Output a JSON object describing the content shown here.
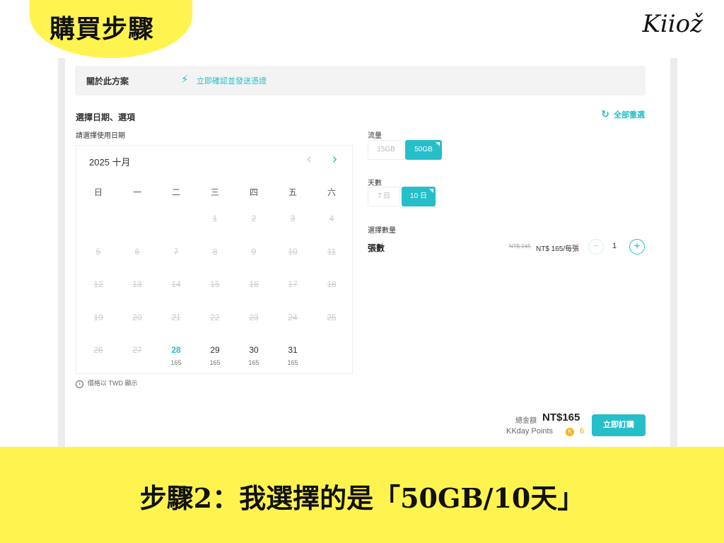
{
  "header": {
    "badge": "購買步驟",
    "logo": "Kiiož"
  },
  "about": {
    "title": "關於此方案",
    "icon": "lightning-icon",
    "link": "立即確認並發送憑證"
  },
  "section": {
    "title": "選擇日期、選項",
    "reset": "全部重選",
    "date_prompt": "請選擇使用日期"
  },
  "calendar": {
    "month": "2025 十月",
    "weekdays": [
      "日",
      "一",
      "二",
      "三",
      "四",
      "五",
      "六"
    ],
    "rows": [
      [
        null,
        null,
        null,
        {
          "d": "1",
          "s": "disabled"
        },
        {
          "d": "2",
          "s": "disabled"
        },
        {
          "d": "3",
          "s": "disabled"
        },
        {
          "d": "4",
          "s": "disabled"
        }
      ],
      [
        {
          "d": "5",
          "s": "disabled"
        },
        {
          "d": "6",
          "s": "disabled"
        },
        {
          "d": "7",
          "s": "disabled"
        },
        {
          "d": "8",
          "s": "disabled"
        },
        {
          "d": "9",
          "s": "disabled"
        },
        {
          "d": "10",
          "s": "disabled"
        },
        {
          "d": "11",
          "s": "disabled"
        }
      ],
      [
        {
          "d": "12",
          "s": "disabled"
        },
        {
          "d": "13",
          "s": "disabled"
        },
        {
          "d": "14",
          "s": "disabled"
        },
        {
          "d": "15",
          "s": "disabled"
        },
        {
          "d": "16",
          "s": "disabled"
        },
        {
          "d": "17",
          "s": "disabled"
        },
        {
          "d": "18",
          "s": "disabled"
        }
      ],
      [
        {
          "d": "19",
          "s": "disabled"
        },
        {
          "d": "20",
          "s": "disabled"
        },
        {
          "d": "21",
          "s": "disabled"
        },
        {
          "d": "22",
          "s": "disabled"
        },
        {
          "d": "23",
          "s": "disabled"
        },
        {
          "d": "24",
          "s": "disabled"
        },
        {
          "d": "25",
          "s": "disabled"
        }
      ],
      [
        {
          "d": "26",
          "s": "disabled"
        },
        {
          "d": "27",
          "s": "disabled"
        },
        {
          "d": "28",
          "s": "selected",
          "p": "165"
        },
        {
          "d": "29",
          "s": "enabled",
          "p": "165"
        },
        {
          "d": "30",
          "s": "enabled",
          "p": "165"
        },
        {
          "d": "31",
          "s": "enabled",
          "p": "165"
        },
        null
      ]
    ],
    "note": "價格以 TWD 顯示"
  },
  "options": {
    "data_label": "流量",
    "data_opts": [
      {
        "label": "15GB",
        "selected": false
      },
      {
        "label": "50GB",
        "selected": true
      }
    ],
    "days_label": "天數",
    "days_opts": [
      {
        "label": "7 日",
        "selected": false
      },
      {
        "label": "10 日",
        "selected": true
      }
    ],
    "qty_section": "選擇數量",
    "qty_label": "張數",
    "orig_price": "NT$ 245",
    "unit_price": "NT$ 165/每張",
    "minus": "−",
    "plus": "+",
    "qty": "1"
  },
  "footer": {
    "total_label": "總金額",
    "total": "NT$165",
    "points_label": "KKday Points",
    "points_coin": "K",
    "points": "6",
    "buy": "立即訂購"
  },
  "caption": "步驟2：我選擇的是「50GB/10天」",
  "colors": {
    "accent": "#26bec9",
    "highlight": "#fff44f"
  }
}
